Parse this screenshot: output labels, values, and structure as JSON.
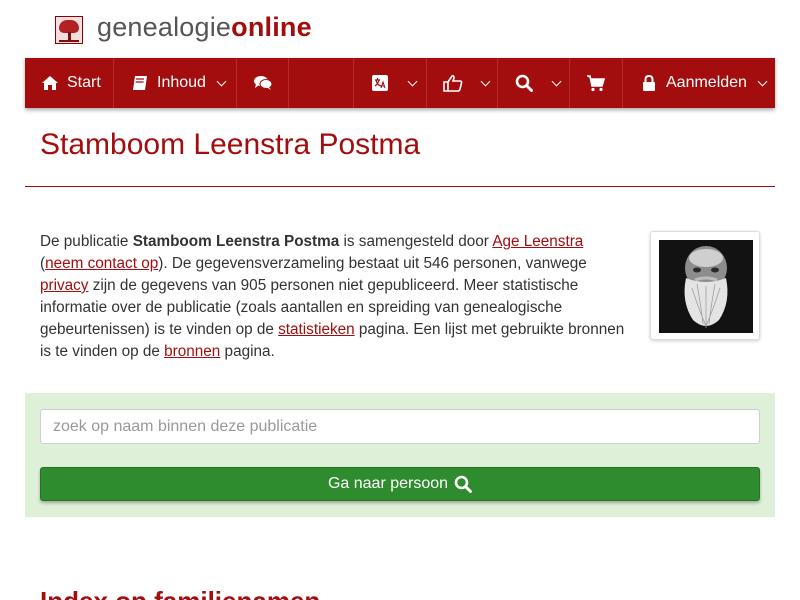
{
  "header": {
    "logo_text_light": "genealogie",
    "logo_text_bold": "online"
  },
  "nav": {
    "start_label": "Start",
    "inhoud_label": "Inhoud",
    "login_label": "Aanmelden",
    "icons": [
      "home-icon",
      "book-icon",
      "comments-icon",
      "language-icon",
      "thumbs-up-icon",
      "search-icon",
      "shopping-cart-icon",
      "lock-icon"
    ]
  },
  "page": {
    "title": "Stamboom Leenstra Postma"
  },
  "intro": {
    "t1": "De publicatie ",
    "pub_name": "Stamboom Leenstra Postma",
    "t2": " is samengesteld door ",
    "author_link": "Age Leenstra",
    "t3": "(",
    "contact_link": "neem contact op",
    "t4": "). De gegevensverzameling bestaat uit 546 personen, vanwege ",
    "privacy_link": "privacy",
    "t5": " zijn de gegevens van 905 personen niet gepubliceerd. Meer statistische informatie over de publicatie (zoals aantallen en spreiding van genealogische gebeurtenissen) is te vinden op de ",
    "stats_link": "statistieken",
    "t6": " pagina. Een lijst met gebruikte bronnen is te vinden op de ",
    "sources_link": "bronnen",
    "t7": " pagina."
  },
  "search": {
    "placeholder": "zoek op naam binnen deze publicatie",
    "button_label": "Ga naar persoon"
  },
  "section": {
    "heading": "Index op familienamen"
  },
  "colors": {
    "brand": "#a30d0d",
    "panel_bg": "#dff0d8",
    "button_green": "#2e8b2e"
  }
}
